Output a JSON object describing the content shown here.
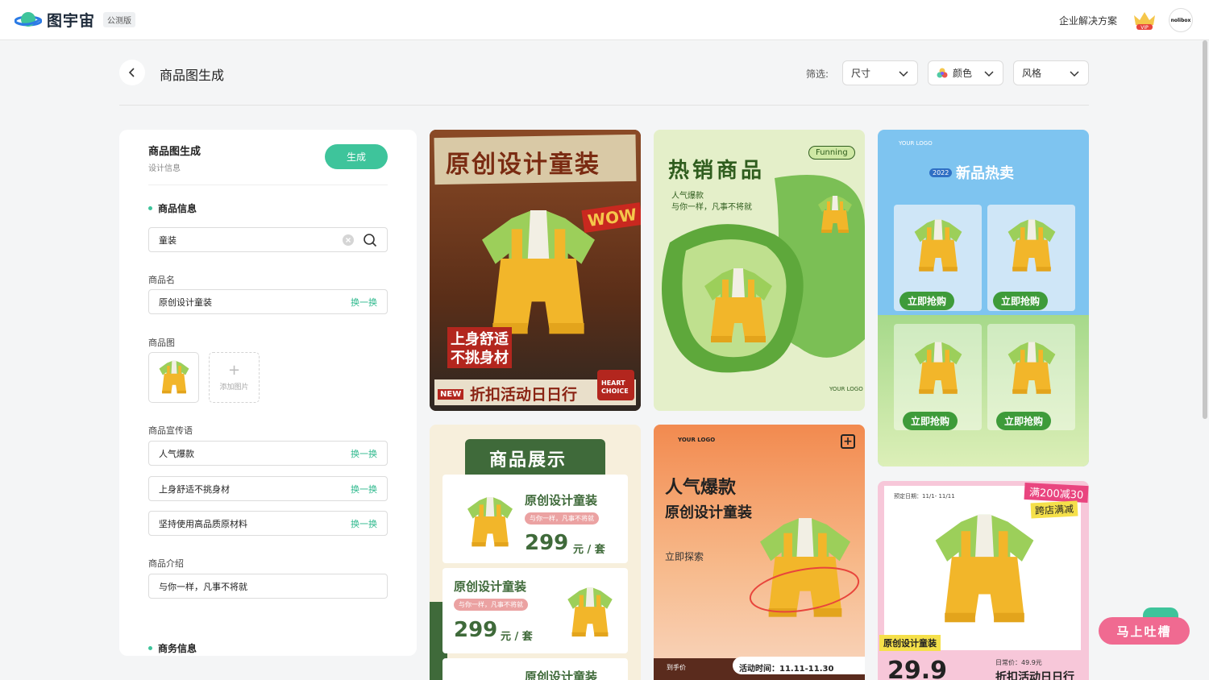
{
  "header": {
    "logo_text": "图宇宙",
    "badge": "公测版",
    "enterprise_link": "企业解决方案",
    "vip_label": "VIP",
    "avatar_text": "nolibox"
  },
  "page": {
    "title": "商品图生成",
    "filter_label": "筛选:",
    "filters": [
      {
        "label": "尺寸"
      },
      {
        "label": "颜色"
      },
      {
        "label": "风格"
      }
    ]
  },
  "panel": {
    "title": "商品图生成",
    "subtitle": "设计信息",
    "generate_button": "生成",
    "section_product": "商品信息",
    "search_value": "童装",
    "name_label": "商品名",
    "name_value": "原创设计童装",
    "swap_label": "换一换",
    "image_label": "商品图",
    "add_image_label": "添加图片",
    "slogan_label": "商品宣传语",
    "slogans": [
      "人气爆款",
      "上身舒适不挑身材",
      "坚持使用高品质原材料"
    ],
    "intro_label": "商品介绍",
    "intro_value": "与你一样，凡事不将就",
    "section_business": "商务信息"
  },
  "cards": {
    "c1": {
      "title": "原创设计童装",
      "wow": "WOW",
      "line1": "上身舒适",
      "line2": "不挑身材",
      "new": "NEW",
      "bottom": "折扣活动日日行",
      "heart1": "HEART",
      "heart2": "CHOICE"
    },
    "c2": {
      "title": "热销商品",
      "tag": "Funning",
      "sub1": "人气爆款",
      "sub2": "与你一样，凡事不将就",
      "logo": "YOUR LOGO"
    },
    "c3": {
      "logo": "YOUR LOGO",
      "year": "2022",
      "title": "新品热卖",
      "buy": "立即抢购"
    },
    "c4": {
      "title": "商品展示",
      "name": "原创设计童装",
      "slogan": "与你一样，凡事不将就",
      "price": "299",
      "unit": "元 / 套"
    },
    "c5": {
      "logo": "YOUR LOGO",
      "title1": "人气爆款",
      "title2": "原创设计童装",
      "explore": "立即探索",
      "price_label": "到手价",
      "activity": "活动时间：11.11-11.30"
    },
    "c6": {
      "date": "预定日期：11/1- 11/11",
      "promo1": "满200减30",
      "promo2": "跨店满减",
      "name": "原创设计童装",
      "price": "29.9",
      "orig": "日常价：49.9元",
      "bottom": "折扣活动日日行"
    }
  },
  "feedback": "马上吐槽",
  "colors": {
    "accent": "#3ec49b",
    "swap": "#2fb98e",
    "feedback": "#f06a91"
  }
}
